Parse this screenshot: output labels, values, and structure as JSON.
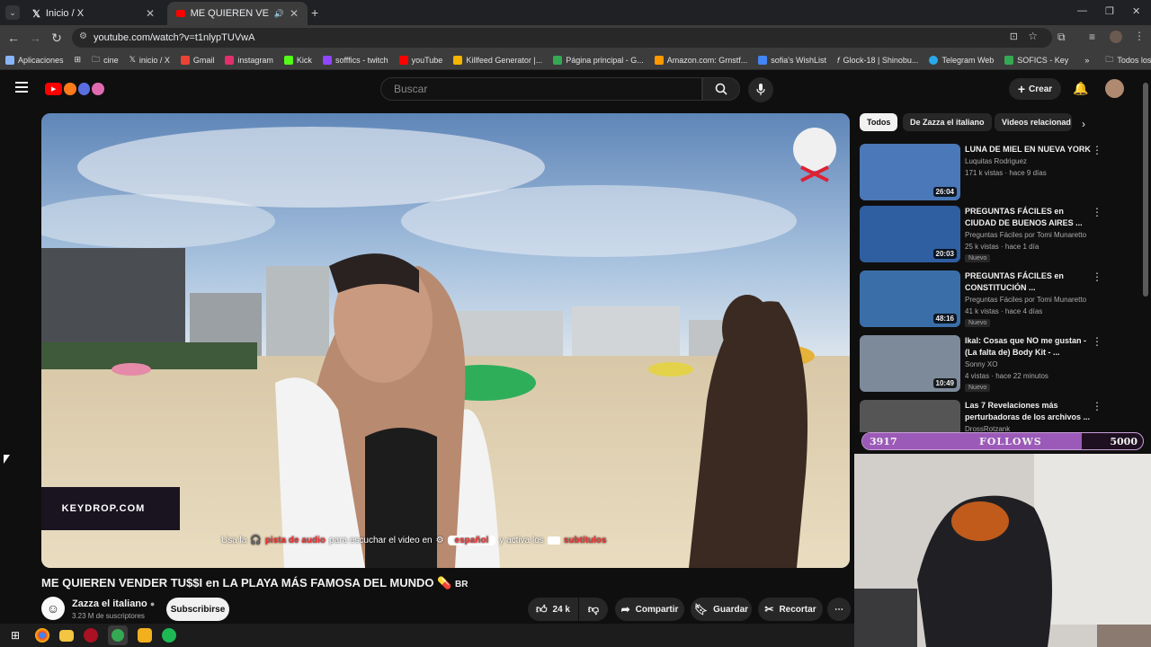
{
  "browser": {
    "tabs": [
      {
        "label": "Inicio / X"
      },
      {
        "label": "ME QUIEREN VENDER TU$$I"
      }
    ],
    "url": "youtube.com/watch?v=t1nlypTUVwA",
    "bookmarks": [
      {
        "label": "Aplicaciones",
        "color": "#8ab4f8"
      },
      {
        "label": "cine",
        "color": "#9aa0a6"
      },
      {
        "label": "inicio / X",
        "color": "#e8eaed"
      },
      {
        "label": "Gmail",
        "color": "#ea4335"
      },
      {
        "label": "instagram",
        "color": "#e1306c"
      },
      {
        "label": "Kick",
        "color": "#53fc18"
      },
      {
        "label": "sofffics - twitch",
        "color": "#9146ff"
      },
      {
        "label": "youTube",
        "color": "#ff0000"
      },
      {
        "label": "Killfeed Generator |...",
        "color": "#f4b400"
      },
      {
        "label": "Página principal - G...",
        "color": "#34a853"
      },
      {
        "label": "Amazon.com: Grnstf...",
        "color": "#ff9900"
      },
      {
        "label": "sofia's WishList",
        "color": "#4285f4"
      },
      {
        "label": "Glock-18 | Shinobu...",
        "color": "#e8eaed"
      },
      {
        "label": "Telegram Web",
        "color": "#29a9eb"
      },
      {
        "label": "SOFICS - Key",
        "color": "#34a853"
      }
    ],
    "all_bookmarks": "Todos los marcadores"
  },
  "youtube": {
    "search_placeholder": "Buscar",
    "create_label": "Crear"
  },
  "video": {
    "title": "ME QUIEREN VENDER TU$$I en LA PLAYA MÁS FAMOSA DEL MUNDO",
    "title_suffix": "BR",
    "overlay_sponsor": "KEYDROP.COM",
    "caption_parts": {
      "p1": "Usa la",
      "p2": "pista de audio",
      "p3": "para escuchar el video en",
      "p4": "español",
      "p5": "y activa los",
      "p6": "subtítulos"
    }
  },
  "channel": {
    "name": "Zazza el italiano",
    "subscribers": "3.23 M de suscriptores",
    "subscribe_label": "Subscribirse"
  },
  "actions": {
    "likes": "24 k",
    "share": "Compartir",
    "save": "Guardar",
    "clip": "Recortar"
  },
  "sidebar": {
    "chips": [
      "Todos",
      "De Zazza el italiano",
      "Videos relacionad"
    ],
    "recommendations": [
      {
        "title": "LUNA DE MIEL EN NUEVA YORK",
        "channel": "Luquitas Rodriguez",
        "meta": "171 k vistas · hace 9 días",
        "duration": "26:04",
        "badge": "",
        "thumb": "#4a78b8"
      },
      {
        "title": "PREGUNTAS FÁCILES en CIUDAD DE BUENOS AIRES ...",
        "channel": "Preguntas Fáciles por Tomi Munaretto",
        "meta": "25 k vistas · hace 1 día",
        "duration": "20:03",
        "badge": "Nuevo",
        "thumb": "#2f5fa0"
      },
      {
        "title": "PREGUNTAS FÁCILES en CONSTITUCIÓN ...",
        "channel": "Preguntas Fáciles por Tomi Munaretto",
        "meta": "41 k vistas · hace 4 días",
        "duration": "48:16",
        "badge": "Nuevo",
        "thumb": "#3a6ea8"
      },
      {
        "title": "Ikal: Cosas que NO me gustan - (La falta de) Body Kit - ...",
        "channel": "Sonny XO",
        "meta": "4 vistas · hace 22 minutos",
        "duration": "10:49",
        "badge": "Nuevo",
        "thumb": "#7d8a9a"
      },
      {
        "title": "Las 7 Revelaciones más perturbadoras de los archivos ...",
        "channel": "DrossRotzank",
        "meta": "",
        "duration": "",
        "badge": "",
        "thumb": "#555"
      }
    ]
  },
  "stream_overlay": {
    "current": "3917",
    "label": "FOLLOWS",
    "goal": "5000",
    "progress_fraction": 0.783,
    "fill_color": "#9b5ab8"
  }
}
